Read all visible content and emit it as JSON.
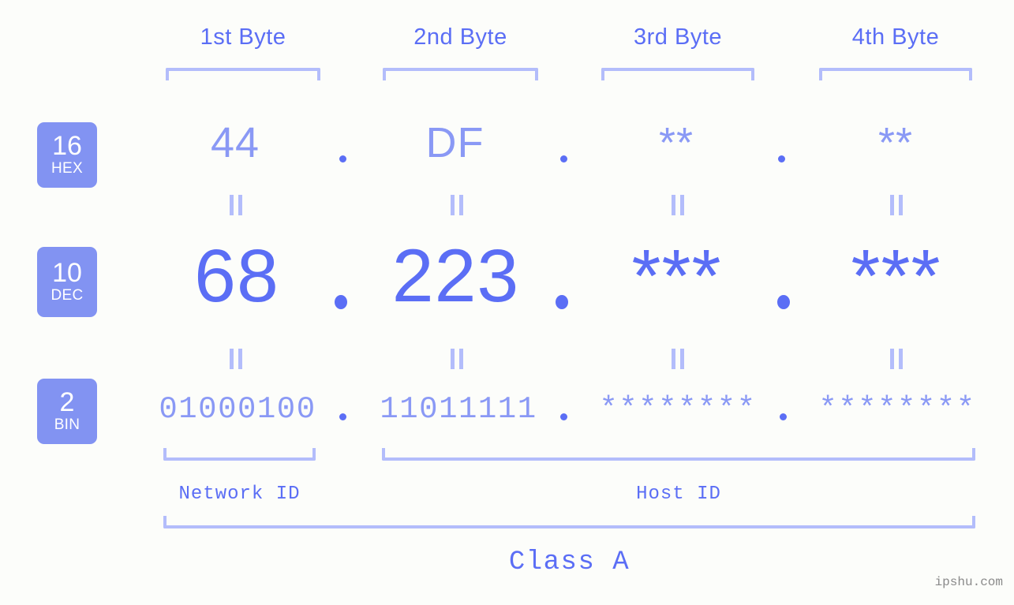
{
  "headers": [
    {
      "label": "1st Byte"
    },
    {
      "label": "2nd Byte"
    },
    {
      "label": "3rd Byte"
    },
    {
      "label": "4th Byte"
    }
  ],
  "rows": [
    {
      "base_number": "16",
      "base_name": "HEX",
      "values": [
        "44",
        "DF",
        "**",
        "**"
      ],
      "separator": "."
    },
    {
      "base_number": "10",
      "base_name": "DEC",
      "values": [
        "68",
        "223",
        "***",
        "***"
      ],
      "separator": "."
    },
    {
      "base_number": "2",
      "base_name": "BIN",
      "values": [
        "01000100",
        "11011111",
        "********",
        "********"
      ],
      "separator": "."
    }
  ],
  "equals_marks": "=",
  "sections": {
    "network_id": "Network ID",
    "host_id": "Host ID",
    "class": "Class A"
  },
  "watermark": "ipshu.com",
  "colors": {
    "background": "#fcfdfa",
    "accent_strong": "#5b6ef5",
    "accent_mid": "#8293f2",
    "accent_light": "#8a99f5",
    "accent_pale": "#b3bdfb",
    "badge_text": "#ffffff",
    "watermark_text": "#8a8a8a"
  }
}
